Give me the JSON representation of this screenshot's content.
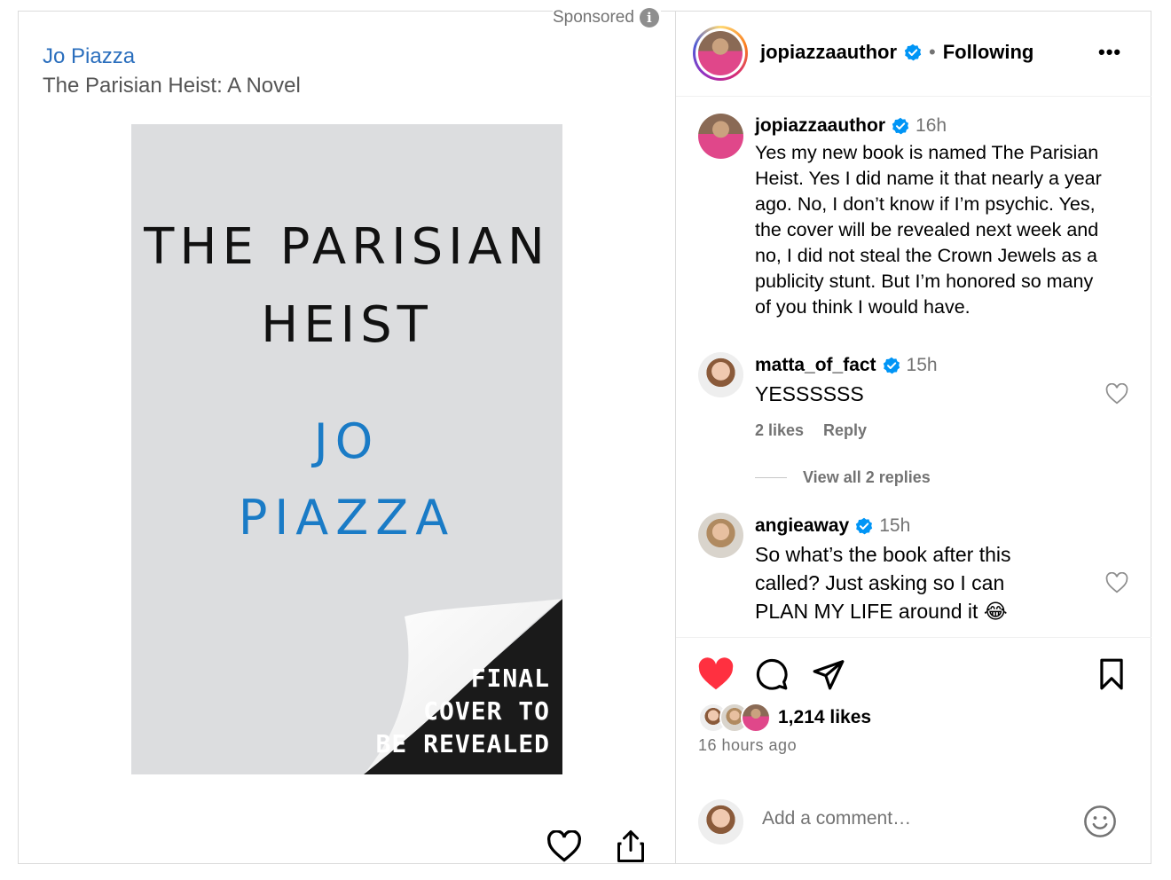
{
  "ad": {
    "sponsored_label": "Sponsored",
    "author_link": "Jo Piazza",
    "book_title": "The Parisian Heist: A Novel",
    "cover": {
      "title_line1": "THE PARISIAN",
      "title_line2": "HEIST",
      "author_line1": "JO",
      "author_line2": "PIAZZA",
      "peel_line1": "FINAL",
      "peel_line2": "COVER TO",
      "peel_line3": "BE REVEALED"
    }
  },
  "post": {
    "header": {
      "username": "jopiazzaauthor",
      "separator": "•",
      "follow_status": "Following",
      "more": "•••"
    },
    "caption": {
      "username": "jopiazzaauthor",
      "time": "16h",
      "lines": [
        "Yes my new book is named The Parisian",
        "Heist. Yes I did name it that nearly a year",
        "ago. No, I don’t know if I’m psychic. Yes,",
        "the cover will be revealed next week and",
        "no, I did not steal the Crown Jewels as a",
        "publicity stunt. But I’m honored so many",
        "of you think I would have."
      ]
    },
    "comments": [
      {
        "username": "matta_of_fact",
        "time": "15h",
        "text": "YESSSSSS",
        "likes": "2 likes",
        "reply": "Reply",
        "view_replies": "View all 2 replies"
      },
      {
        "username": "angieaway",
        "time": "15h",
        "lines": [
          "So what’s the book after this",
          "called? Just asking so I can",
          "PLAN MY LIFE around it 😂"
        ]
      }
    ],
    "likes_count": "1,214 likes",
    "time_ago": "16 hours ago",
    "comment_placeholder": "Add a comment…",
    "colors": {
      "like_red": "#ff3040",
      "verified_blue": "#0095f6",
      "link_blue": "#2a6ebd",
      "muted": "#737373"
    }
  }
}
